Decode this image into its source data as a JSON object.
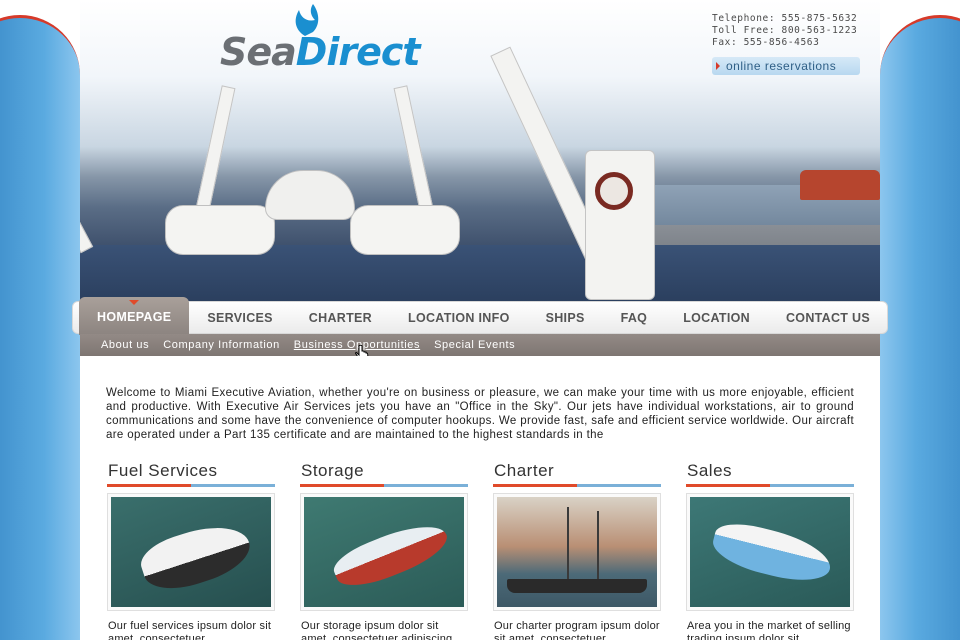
{
  "header": {
    "logo_sea": "Sea",
    "logo_direct": "Direct",
    "telephone": "Telephone: 555-875-5632",
    "toll_free": "Toll Free: 800-563-1223",
    "fax": "Fax: 555-856-4563",
    "reservations_label": "online reservations"
  },
  "nav": {
    "items": [
      {
        "label": "HOMEPAGE"
      },
      {
        "label": "SERVICES"
      },
      {
        "label": "CHARTER"
      },
      {
        "label": "LOCATION INFO"
      },
      {
        "label": "SHIPS"
      },
      {
        "label": "FAQ"
      },
      {
        "label": "LOCATION"
      },
      {
        "label": "CONTACT US"
      }
    ],
    "active": "HOMEPAGE"
  },
  "subnav": {
    "items": [
      {
        "label": "About us"
      },
      {
        "label": "Company Information"
      },
      {
        "label": "Business Opportunities"
      },
      {
        "label": "Special Events"
      }
    ]
  },
  "main": {
    "intro": "Welcome to Miami Executive Aviation, whether you're on business or pleasure, we can make your time with us more enjoyable, efficient and productive. With Executive Air Services jets you have an \"Office in the Sky\". Our jets have individual workstations, air to ground communications and some have the convenience of computer hookups. We provide fast, safe and efficient service worldwide. Our aircraft are operated under a Part 135 certificate and are maintained to the highest standards in the",
    "cards": [
      {
        "title": "Fuel Services",
        "text": "Our fuel services ipsum dolor sit amet, consectetuer"
      },
      {
        "title": "Storage",
        "text": "Our storage ipsum dolor sit amet, consectetuer adipiscing"
      },
      {
        "title": "Charter",
        "text": "Our charter program ipsum dolor sit amet, consectetuer"
      },
      {
        "title": "Sales",
        "text": "Area you in the market of selling trading ipsum dolor sit"
      }
    ]
  },
  "colors": {
    "accent_red": "#e04a2a",
    "brand_blue": "#1a8fd0",
    "side_blue": "#3e8ec8"
  }
}
